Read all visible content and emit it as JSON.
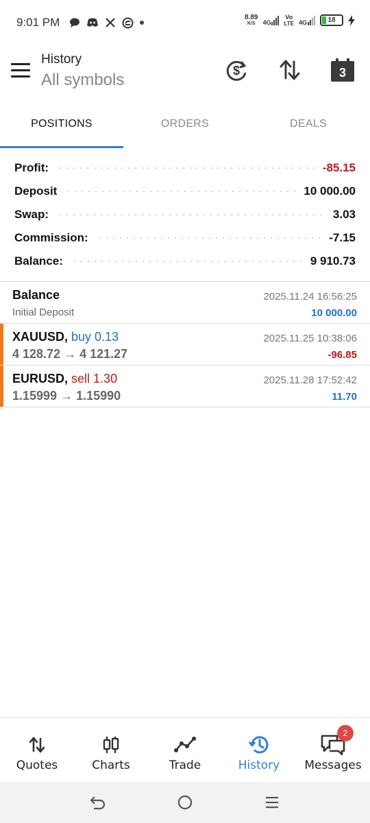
{
  "status_bar": {
    "time": "9:01 PM",
    "net_speed_value": "8.89",
    "net_speed_unit": "K/S",
    "sim1": "4G",
    "sim2_top": "Vo",
    "sim2_bottom": "LTE",
    "sim2": "4G",
    "battery": "18",
    "battery_color": "#3cb34a"
  },
  "header": {
    "title": "History",
    "subtitle": "All symbols",
    "calendar_day": "3"
  },
  "tabs": [
    {
      "label": "POSITIONS",
      "active": true
    },
    {
      "label": "ORDERS",
      "active": false
    },
    {
      "label": "DEALS",
      "active": false
    }
  ],
  "summary": [
    {
      "label": "Profit:",
      "value": "-85.15"
    },
    {
      "label": "Deposit",
      "value": "10 000.00"
    },
    {
      "label": "Swap:",
      "value": "3.03"
    },
    {
      "label": "Commission:",
      "value": "-7.15"
    },
    {
      "label": "Balance:",
      "value": "9 910.73"
    }
  ],
  "rows": [
    {
      "symbol": "Balance",
      "side": "",
      "detail": "Initial Deposit",
      "datetime": "2025.11.24 16:56:25",
      "amount": "10 000.00"
    },
    {
      "symbol": "XAUUSD,",
      "side": "buy 0.13",
      "detail": "4 128.72 → 4 121.27",
      "datetime": "2025.11.25 10:38:06",
      "amount": "-96.85"
    },
    {
      "symbol": "EURUSD,",
      "side": "sell 1.30",
      "detail": "1.15999 → 1.15990",
      "datetime": "2025.11.28 17:52:42",
      "amount": "11.70"
    }
  ],
  "bottom_nav": [
    {
      "label": "Quotes",
      "icon": "quotes-arrows-icon"
    },
    {
      "label": "Charts",
      "icon": "candlestick-icon"
    },
    {
      "label": "Trade",
      "icon": "trade-line-icon"
    },
    {
      "label": "History",
      "icon": "history-clock-icon",
      "active": true
    },
    {
      "label": "Messages",
      "icon": "messages-icon",
      "badge": "2"
    }
  ],
  "colors": {
    "accent": "#2f7fd8",
    "negative": "#c01818",
    "positive": "#1f6fcc",
    "position_marker": "#f07a1a",
    "badge": "#e04848"
  }
}
